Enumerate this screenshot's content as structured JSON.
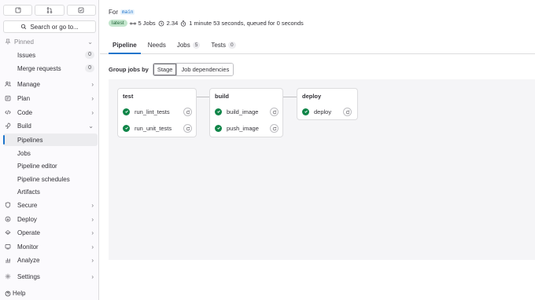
{
  "sidebar": {
    "search_label": "Search or go to...",
    "pinned_label": "Pinned",
    "pinned_items": [
      {
        "label": "Issues",
        "count": "0"
      },
      {
        "label": "Merge requests",
        "count": "0"
      }
    ],
    "sections": [
      {
        "label": "Manage",
        "icon": "users-icon"
      },
      {
        "label": "Plan",
        "icon": "plan-icon"
      },
      {
        "label": "Code",
        "icon": "code-icon"
      },
      {
        "label": "Build",
        "icon": "rocket-icon"
      }
    ],
    "build_items": [
      "Pipelines",
      "Jobs",
      "Pipeline editor",
      "Pipeline schedules",
      "Artifacts"
    ],
    "more_sections": [
      {
        "label": "Secure",
        "icon": "shield-icon"
      },
      {
        "label": "Deploy",
        "icon": "deploy-icon"
      },
      {
        "label": "Operate",
        "icon": "cloud-icon"
      },
      {
        "label": "Monitor",
        "icon": "monitor-icon"
      },
      {
        "label": "Analyze",
        "icon": "chart-icon"
      }
    ],
    "settings_label": "Settings",
    "help_label": "Help"
  },
  "header": {
    "for_label": "For",
    "branch": "main",
    "latest_badge": "latest",
    "jobs_summary": "5 Jobs",
    "duration_value": "2.34",
    "time_summary": "1 minute 53 seconds, queued for 0 seconds"
  },
  "tabs": [
    {
      "label": "Pipeline",
      "count": null
    },
    {
      "label": "Needs",
      "count": null
    },
    {
      "label": "Jobs",
      "count": "5"
    },
    {
      "label": "Tests",
      "count": "0"
    }
  ],
  "group_by": {
    "label": "Group jobs by",
    "options": [
      "Stage",
      "Job dependencies"
    ],
    "selected": "Stage"
  },
  "stages": [
    {
      "name": "test",
      "jobs": [
        "run_lint_tests",
        "run_unit_tests"
      ]
    },
    {
      "name": "build",
      "jobs": [
        "build_image",
        "push_image"
      ]
    },
    {
      "name": "deploy",
      "jobs": [
        "deploy"
      ]
    }
  ],
  "colors": {
    "accent": "#1f75cb",
    "success": "#108548",
    "latest_badge_bg": "#c3e6cd"
  }
}
